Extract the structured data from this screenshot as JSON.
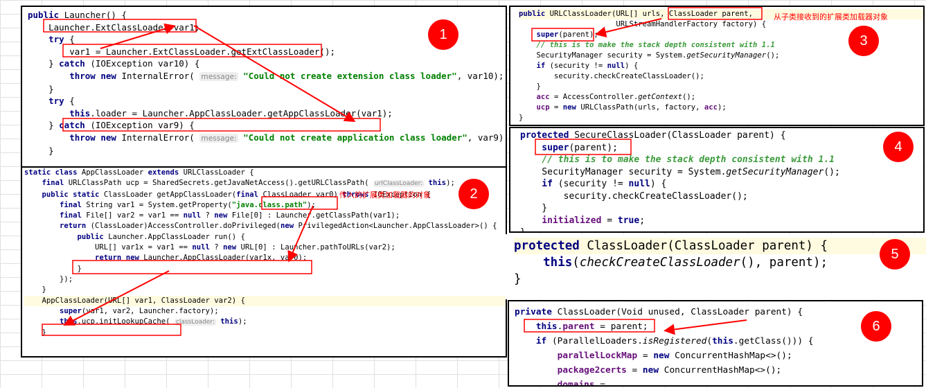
{
  "panels": [
    {
      "id": "launcher",
      "badge": "1",
      "lines": [
        [
          [
            "k",
            "public "
          ],
          [
            "n",
            "Launcher() {"
          ]
        ],
        [
          [
            "n",
            "    Launcher.ExtClassLoader var1;"
          ]
        ],
        [
          [
            "k",
            "    try "
          ],
          [
            "n",
            "{"
          ]
        ],
        [
          [
            "n",
            "        var1 = Launcher.ExtClassLoader.getExtClassLoader();"
          ]
        ],
        [
          [
            "n",
            "    } "
          ],
          [
            "k",
            "catch "
          ],
          [
            "n",
            "(IOException var10) {"
          ]
        ],
        [
          [
            "k",
            "        throw new "
          ],
          [
            "n",
            "InternalError( "
          ],
          [
            "h",
            "message:"
          ],
          [
            "s",
            " \"Could not create extension class loader\""
          ],
          [
            "n",
            ", var10);"
          ]
        ],
        [
          [
            "n",
            "    }"
          ]
        ],
        [
          [
            "n",
            ""
          ]
        ],
        [
          [
            "k",
            "    try "
          ],
          [
            "n",
            "{"
          ]
        ],
        [
          [
            "k",
            "        this"
          ],
          [
            "n",
            ".loader = Launcher.AppClassLoader.getAppClassLoader(var1);"
          ]
        ],
        [
          [
            "n",
            "    } "
          ],
          [
            "k",
            "catch "
          ],
          [
            "n",
            "(IOException var9) {"
          ]
        ],
        [
          [
            "k",
            "        throw new "
          ],
          [
            "n",
            "InternalError( "
          ],
          [
            "h",
            "message:"
          ],
          [
            "s",
            " \"Could not create application class loader\""
          ],
          [
            "n",
            ", var9);"
          ]
        ],
        [
          [
            "n",
            "    }"
          ]
        ]
      ]
    },
    {
      "id": "app-class-loader",
      "badge": "2",
      "note": "传入的扩展类加载器的对象",
      "lines": [
        [
          [
            "k",
            "static class "
          ],
          [
            "n",
            "AppClassLoader "
          ],
          [
            "k",
            "extends "
          ],
          [
            "n",
            "URLClassLoader {"
          ]
        ],
        [
          [
            "k",
            "    final "
          ],
          [
            "n",
            "URLClassPath ucp = SharedSecrets.getJavaNetAccess().getURLClassPath( "
          ],
          [
            "h",
            "urlClassLoader:"
          ],
          [
            "k",
            " this"
          ],
          [
            "n",
            ");"
          ]
        ],
        [
          [
            "n",
            ""
          ]
        ],
        [
          [
            "k",
            "    public static "
          ],
          [
            "n",
            "ClassLoader getAppClassLoader("
          ],
          [
            "k",
            "final "
          ],
          [
            "n",
            "ClassLoader var0) "
          ],
          [
            "k",
            "throws "
          ],
          [
            "n",
            "IOException {"
          ]
        ],
        [
          [
            "k",
            "        final "
          ],
          [
            "n",
            "String var1 = System.getProperty("
          ],
          [
            "s",
            "\"java.class.path\""
          ],
          [
            "n",
            ");"
          ]
        ],
        [
          [
            "k",
            "        final "
          ],
          [
            "n",
            "File[] var2 = var1 == "
          ],
          [
            "k",
            "null "
          ],
          [
            "n",
            "? "
          ],
          [
            "k",
            "new "
          ],
          [
            "n",
            "File[0] : Launcher.getClassPath(var1);"
          ]
        ],
        [
          [
            "k",
            "        return "
          ],
          [
            "n",
            "(ClassLoader)AccessController.doPrivileged("
          ],
          [
            "k",
            "new "
          ],
          [
            "n",
            "PrivilegedAction<Launcher.AppClassLoader>() {"
          ]
        ],
        [
          [
            "k",
            "            public "
          ],
          [
            "n",
            "Launcher.AppClassLoader run() {"
          ]
        ],
        [
          [
            "n",
            "                URL[] var1x = var1 == "
          ],
          [
            "k",
            "null "
          ],
          [
            "n",
            "? "
          ],
          [
            "k",
            "new "
          ],
          [
            "n",
            "URL[0] : Launcher.pathToURLs(var2);"
          ]
        ],
        [
          [
            "k",
            "                return new "
          ],
          [
            "n",
            "Launcher.AppClassLoader(var1x, var0);"
          ]
        ],
        [
          [
            "n",
            "            }"
          ]
        ],
        [
          [
            "n",
            "        });"
          ]
        ],
        [
          [
            "n",
            "    }"
          ]
        ],
        [
          [
            "n",
            ""
          ]
        ],
        [
          [
            "n",
            "    AppClassLoader(URL[] var1, ClassLoader var2) {"
          ]
        ],
        [
          [
            "k",
            "        super"
          ],
          [
            "n",
            "(var1, var2, Launcher.factory);"
          ]
        ],
        [
          [
            "k",
            "        this"
          ],
          [
            "n",
            ".ucp.initLookupCache( "
          ],
          [
            "h",
            "classLoader:"
          ],
          [
            "k",
            " this"
          ],
          [
            "n",
            ");"
          ]
        ],
        [
          [
            "n",
            "    }"
          ]
        ]
      ]
    },
    {
      "id": "url-class-loader",
      "badge": "3",
      "note": "从子类接收到的扩展类加载器对象",
      "lines": [
        [
          [
            "k",
            "public "
          ],
          [
            "n",
            "URLClassLoader(URL[] urls, ClassLoader parent,"
          ]
        ],
        [
          [
            "n",
            "                      URLStreamHandlerFactory factory) {"
          ]
        ],
        [
          [
            "k",
            "    super"
          ],
          [
            "n",
            "(parent);"
          ]
        ],
        [
          [
            "cg",
            "    // this is to make the stack depth consistent with 1.1"
          ]
        ],
        [
          [
            "n",
            "    SecurityManager security = System."
          ],
          [
            "i",
            "getSecurityManager"
          ],
          [
            "n",
            "();"
          ]
        ],
        [
          [
            "k",
            "    if "
          ],
          [
            "n",
            "(security != "
          ],
          [
            "k",
            "null"
          ],
          [
            "n",
            ") {"
          ]
        ],
        [
          [
            "n",
            "        security.checkCreateClassLoader();"
          ]
        ],
        [
          [
            "n",
            "    }"
          ]
        ],
        [
          [
            "f",
            "    acc "
          ],
          [
            "n",
            "= AccessController."
          ],
          [
            "i",
            "getContext"
          ],
          [
            "n",
            "();"
          ]
        ],
        [
          [
            "f",
            "    ucp "
          ],
          [
            "n",
            "= "
          ],
          [
            "k",
            "new "
          ],
          [
            "n",
            "URLClassPath(urls, factory, "
          ],
          [
            "f",
            "acc"
          ],
          [
            "n",
            ");"
          ]
        ],
        [
          [
            "n",
            "}"
          ]
        ]
      ]
    },
    {
      "id": "secure-class-loader",
      "badge": "4",
      "lines": [
        [
          [
            "k",
            "protected "
          ],
          [
            "n",
            "SecureClassLoader(ClassLoader parent) {"
          ]
        ],
        [
          [
            "k",
            "    super"
          ],
          [
            "n",
            "(parent);"
          ]
        ],
        [
          [
            "cg",
            "    // this is to make the stack depth consistent with 1.1"
          ]
        ],
        [
          [
            "n",
            "    SecurityManager security = System."
          ],
          [
            "i",
            "getSecurityManager"
          ],
          [
            "n",
            "();"
          ]
        ],
        [
          [
            "k",
            "    if "
          ],
          [
            "n",
            "(security != "
          ],
          [
            "k",
            "null"
          ],
          [
            "n",
            ") {"
          ]
        ],
        [
          [
            "n",
            "        security.checkCreateClassLoader();"
          ]
        ],
        [
          [
            "n",
            "    }"
          ]
        ],
        [
          [
            "f",
            "    initialized "
          ],
          [
            "n",
            "= "
          ],
          [
            "k",
            "true"
          ],
          [
            "n",
            ";"
          ]
        ],
        [
          [
            "n",
            "}"
          ]
        ]
      ]
    },
    {
      "id": "class-loader-protected",
      "badge": "5",
      "lines": [
        [
          [
            "k",
            "protected "
          ],
          [
            "n",
            "ClassLoader(ClassLoader parent) {"
          ]
        ],
        [
          [
            "k",
            "    this"
          ],
          [
            "n",
            "("
          ],
          [
            "i",
            "checkCreateClassLoader"
          ],
          [
            "n",
            "(), parent);"
          ]
        ],
        [
          [
            "n",
            "}"
          ]
        ]
      ]
    },
    {
      "id": "class-loader-private",
      "badge": "6",
      "lines": [
        [
          [
            "k",
            "private "
          ],
          [
            "n",
            "ClassLoader(Void unused, ClassLoader parent) {"
          ]
        ],
        [
          [
            "k",
            "    this"
          ],
          [
            "n",
            "."
          ],
          [
            "f",
            "parent "
          ],
          [
            "n",
            "= parent;"
          ]
        ],
        [
          [
            "k",
            "    if "
          ],
          [
            "n",
            "(ParallelLoaders."
          ],
          [
            "i",
            "isRegistered"
          ],
          [
            "n",
            "("
          ],
          [
            "k",
            "this"
          ],
          [
            "n",
            ".getClass())) {"
          ]
        ],
        [
          [
            "f",
            "        parallelLockMap "
          ],
          [
            "n",
            "= "
          ],
          [
            "k",
            "new "
          ],
          [
            "n",
            "ConcurrentHashMap<>();"
          ]
        ],
        [
          [
            "f",
            "        package2certs "
          ],
          [
            "n",
            "= "
          ],
          [
            "k",
            "new "
          ],
          [
            "n",
            "ConcurrentHashMap<>();"
          ]
        ],
        [
          [
            "f",
            "        domains "
          ],
          [
            "n",
            "="
          ]
        ]
      ]
    }
  ],
  "colors": {
    "annotation": "#ff0000",
    "keyword": "#000080",
    "string": "#008000"
  }
}
